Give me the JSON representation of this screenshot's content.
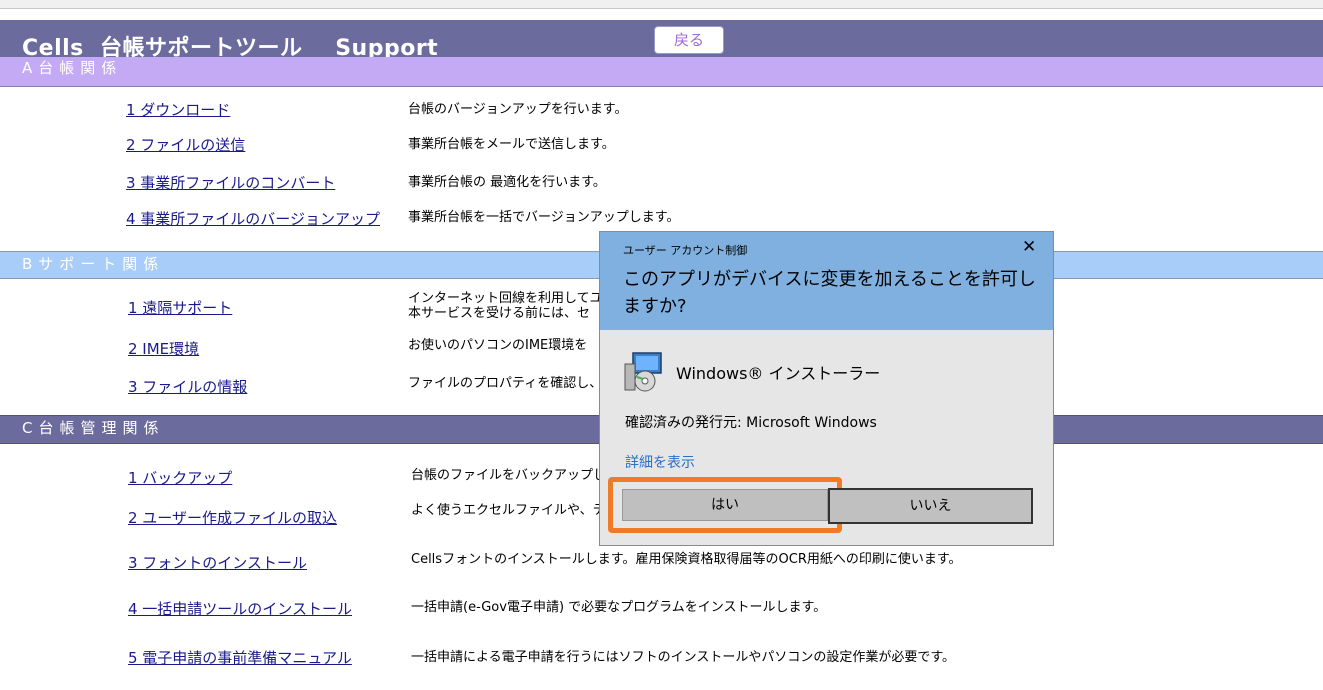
{
  "header": {
    "title": "Cells  台帳サポートツール    Support",
    "back_label": "戻る"
  },
  "sections": {
    "a": {
      "heading": "A台帳関係",
      "items": [
        {
          "link": "1  ダウンロード",
          "desc": "台帳のバージョンアップを行います。"
        },
        {
          "link": "2  ファイルの送信",
          "desc": "事業所台帳をメールで送信します。"
        },
        {
          "link": "3  事業所ファイルのコンバート",
          "desc": "事業所台帳の 最適化を行います。"
        },
        {
          "link": "4  事業所ファイルのバージョンアップ",
          "desc": "事業所台帳を一括でバージョンアップします。"
        }
      ]
    },
    "b": {
      "heading": "Bサポート関係",
      "items": [
        {
          "link": "1  遠隔サポート",
          "desc": "インターネット回線を利用してユ",
          "desc2": "本サービスを受ける前には、セ"
        },
        {
          "link": "2  IME環境",
          "desc": "お使いのパソコンのIME環境を"
        },
        {
          "link": "3  ファイルの情報",
          "desc": "ファイルのプロパティを確認し、"
        }
      ]
    },
    "c": {
      "heading": "C台帳管理関係",
      "items": [
        {
          "link": "1  バックアップ",
          "desc": "台帳のファイルをバックアップし"
        },
        {
          "link": "2  ユーザー作成ファイルの取込",
          "desc": "よく使うエクセルファイルや、テ"
        },
        {
          "link": "3  フォントのインストール",
          "desc": "Cellsフォントのインストールします。雇用保険資格取得届等のOCR用紙への印刷に使います。"
        },
        {
          "link": "4  一括申請ツールのインストール",
          "desc": "一括申請(e-Gov電子申請) で必要なプログラムをインストールします。"
        },
        {
          "link": "5  電子申請の事前準備マニュアル",
          "desc": "一括申請による電子申請を行うにはソフトのインストールやパソコンの設定作業が必要です。"
        }
      ]
    }
  },
  "uac": {
    "caption": "ユーザー アカウント制御",
    "question": "このアプリがデバイスに変更を加えることを許可しますか?",
    "program_name": "Windows® インストーラー",
    "publisher": "確認済みの発行元: Microsoft Windows",
    "details_link": "詳細を表示",
    "yes_label": "はい",
    "no_label": "いいえ",
    "close_glyph": "✕",
    "program_icon": "installer-icon"
  },
  "colors": {
    "title_bar": "#6b6b9e",
    "section_a": "#c4a9f5",
    "section_b": "#a8cdf8",
    "section_c": "#6b6b9e",
    "uac_header": "#7fb0e0",
    "highlight": "#f07a28"
  }
}
